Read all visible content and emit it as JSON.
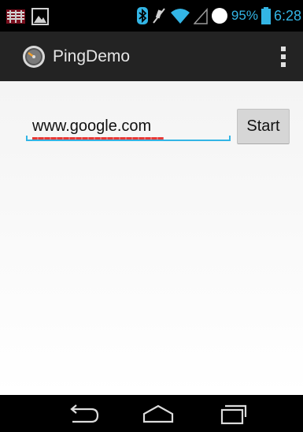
{
  "status_bar": {
    "battery_percent": "95%",
    "time": "6:28",
    "accent_color": "#33b5e5",
    "icons": [
      "notification-app-icon",
      "image-notification-icon",
      "bluetooth-icon",
      "mute-icon",
      "wifi-icon",
      "signal-icon",
      "sync-circle-icon",
      "battery-icon"
    ]
  },
  "action_bar": {
    "title": "PingDemo",
    "app_icon": "gauge-icon",
    "overflow_icon": "overflow-menu-icon"
  },
  "form": {
    "host_value": "www.google.com",
    "start_label": "Start"
  },
  "nav_bar": {
    "icons": [
      "back-icon",
      "home-icon",
      "recent-apps-icon"
    ]
  }
}
